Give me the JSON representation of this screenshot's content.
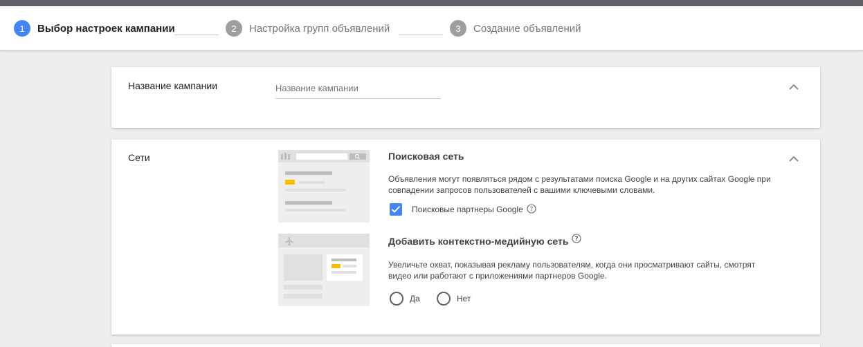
{
  "stepper": {
    "steps": [
      {
        "number": "1",
        "label": "Выбор настроек кампании",
        "state": "active"
      },
      {
        "number": "2",
        "label": "Настройка групп объявлений",
        "state": "inactive"
      },
      {
        "number": "3",
        "label": "Создание объявлений",
        "state": "inactive"
      }
    ]
  },
  "campaign_name": {
    "label": "Название кампании",
    "placeholder": "Название кампании",
    "value": ""
  },
  "networks": {
    "label": "Сети",
    "search": {
      "title": "Поисковая сеть",
      "description": "Объявления могут появляться рядом с результатами поиска Google и на других сайтах Google при совпадении запросов пользователей с вашими ключевыми словами.",
      "partners_label": "Поисковые партнеры Google",
      "partners_checked": true
    },
    "display": {
      "title": "Добавить контекстно-медийную сеть",
      "description": "Увеличьте охват, показывая рекламу пользователям, когда они просматривают сайты, смотрят видео или работают с приложениями партнеров Google.",
      "options": [
        "Да",
        "Нет"
      ]
    }
  },
  "colors": {
    "accent": "#4285f4",
    "inactive_step": "#9e9e9e",
    "illustration_highlight": "#fbbc04"
  },
  "icons": {
    "collapse": "chevron-up-icon",
    "help": "help-circle-icon",
    "check": "check-icon",
    "plane": "airplane-icon",
    "search": "search-icon"
  }
}
